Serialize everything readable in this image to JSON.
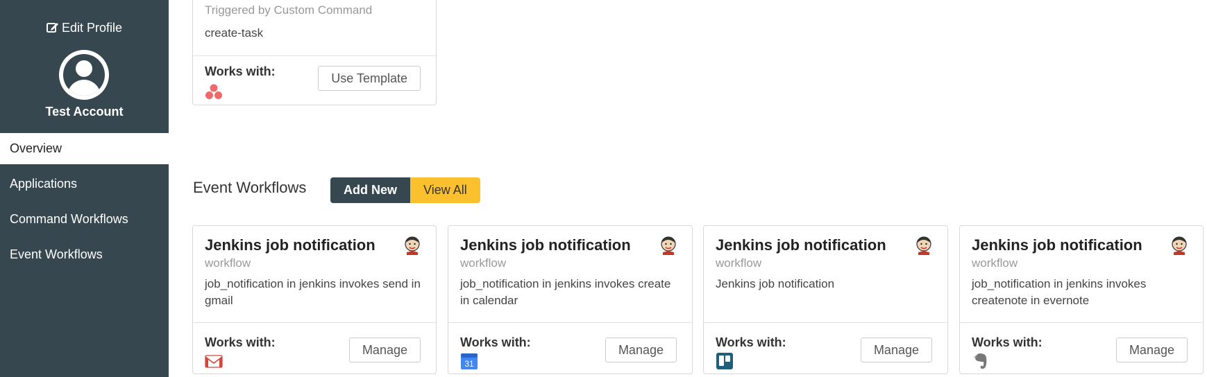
{
  "sidebar": {
    "edit_profile_label": "Edit Profile",
    "account_name": "Test Account",
    "nav": [
      {
        "label": "Overview",
        "active": true
      },
      {
        "label": "Applications",
        "active": false
      },
      {
        "label": "Command Workflows",
        "active": false
      },
      {
        "label": "Event Workflows",
        "active": false
      }
    ]
  },
  "command_card": {
    "trigger_text": "Triggered by Custom Command",
    "command": "create-task",
    "works_with_label": "Works with:",
    "works_with_icon": "asana-icon",
    "button_label": "Use Template"
  },
  "event_section": {
    "title": "Event Workflows",
    "add_new_label": "Add New",
    "view_all_label": "View All"
  },
  "event_cards": [
    {
      "title": "Jenkins job notification",
      "subtitle": "workflow",
      "desc": "job_notification in jenkins invokes send in gmail",
      "works_with_label": "Works with:",
      "works_with_icon": "gmail-icon",
      "button_label": "Manage"
    },
    {
      "title": "Jenkins job notification",
      "subtitle": "workflow",
      "desc": "job_notification in jenkins invokes create in calendar",
      "works_with_label": "Works with:",
      "works_with_icon": "google-calendar-icon",
      "calendar_day": "31",
      "button_label": "Manage"
    },
    {
      "title": "Jenkins job notification",
      "subtitle": "workflow",
      "desc": "Jenkins job notification",
      "works_with_label": "Works with:",
      "works_with_icon": "trello-icon",
      "button_label": "Manage"
    },
    {
      "title": "Jenkins job notification",
      "subtitle": "workflow",
      "desc": "job_notification in jenkins invokes createnote in evernote",
      "works_with_label": "Works with:",
      "works_with_icon": "evernote-icon",
      "button_label": "Manage"
    }
  ],
  "colors": {
    "sidebar_bg": "#37474f",
    "accent_yellow": "#fbc02d",
    "gmail_red": "#d44638",
    "calendar_blue": "#4285f4",
    "trello_teal": "#1f5f7a",
    "asana_pink": "#f06a6a",
    "evernote_gray": "#777777"
  }
}
